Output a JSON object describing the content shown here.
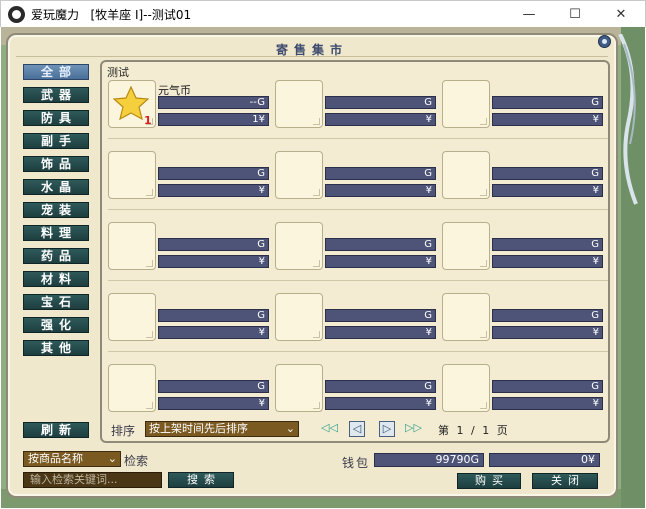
{
  "window": {
    "title": "爱玩魔力   [牧羊座 I]--测试01",
    "minimize_glyph": "—",
    "maximize_glyph": "☐",
    "close_glyph": "✕"
  },
  "panel": {
    "title": "寄售集市"
  },
  "categories": [
    {
      "label": "全部",
      "active": true
    },
    {
      "label": "武器"
    },
    {
      "label": "防具"
    },
    {
      "label": "副手"
    },
    {
      "label": "饰品"
    },
    {
      "label": "水晶"
    },
    {
      "label": "宠装"
    },
    {
      "label": "料理"
    },
    {
      "label": "药品"
    },
    {
      "label": "材料"
    },
    {
      "label": "宝石"
    },
    {
      "label": "强化"
    },
    {
      "label": "其他"
    }
  ],
  "refresh_label": "刷新",
  "listing": {
    "current_category": "测试",
    "items": [
      {
        "name": "元气币",
        "gold": "--G",
        "yen": "1¥",
        "count": "1",
        "icon": "star-icon"
      },
      {
        "name": "",
        "gold": "G",
        "yen": "¥"
      },
      {
        "name": "",
        "gold": "G",
        "yen": "¥"
      },
      {
        "name": "",
        "gold": "G",
        "yen": "¥"
      },
      {
        "name": "",
        "gold": "G",
        "yen": "¥"
      },
      {
        "name": "",
        "gold": "G",
        "yen": "¥"
      },
      {
        "name": "",
        "gold": "G",
        "yen": "¥"
      },
      {
        "name": "",
        "gold": "G",
        "yen": "¥"
      },
      {
        "name": "",
        "gold": "G",
        "yen": "¥"
      },
      {
        "name": "",
        "gold": "G",
        "yen": "¥"
      },
      {
        "name": "",
        "gold": "G",
        "yen": "¥"
      },
      {
        "name": "",
        "gold": "G",
        "yen": "¥"
      },
      {
        "name": "",
        "gold": "G",
        "yen": "¥"
      },
      {
        "name": "",
        "gold": "G",
        "yen": "¥"
      },
      {
        "name": "",
        "gold": "G",
        "yen": "¥"
      }
    ]
  },
  "sort": {
    "label": "排序",
    "selected": "按上架时间先后排序",
    "arrow": "⌄"
  },
  "pagination": {
    "first": "◁◁",
    "prev": "◁",
    "next": "▷",
    "last": "▷▷",
    "info": "第 1 / 1 页"
  },
  "search": {
    "type_selected": "按商品名称",
    "type_arrow": "⌄",
    "label": "检索",
    "placeholder": "输入检索关键词...",
    "button": "搜索"
  },
  "wallet": {
    "label": "钱包",
    "gold": "99790G",
    "yen": "0¥"
  },
  "buy_label": "购买",
  "close_label": "关闭",
  "colors": {
    "panel_bg": "#efe8cc",
    "category_button": "#2f5a5a",
    "category_active": "#6f93b8",
    "price_bar": "#4e5478",
    "select_bg": "#7a5a21"
  }
}
